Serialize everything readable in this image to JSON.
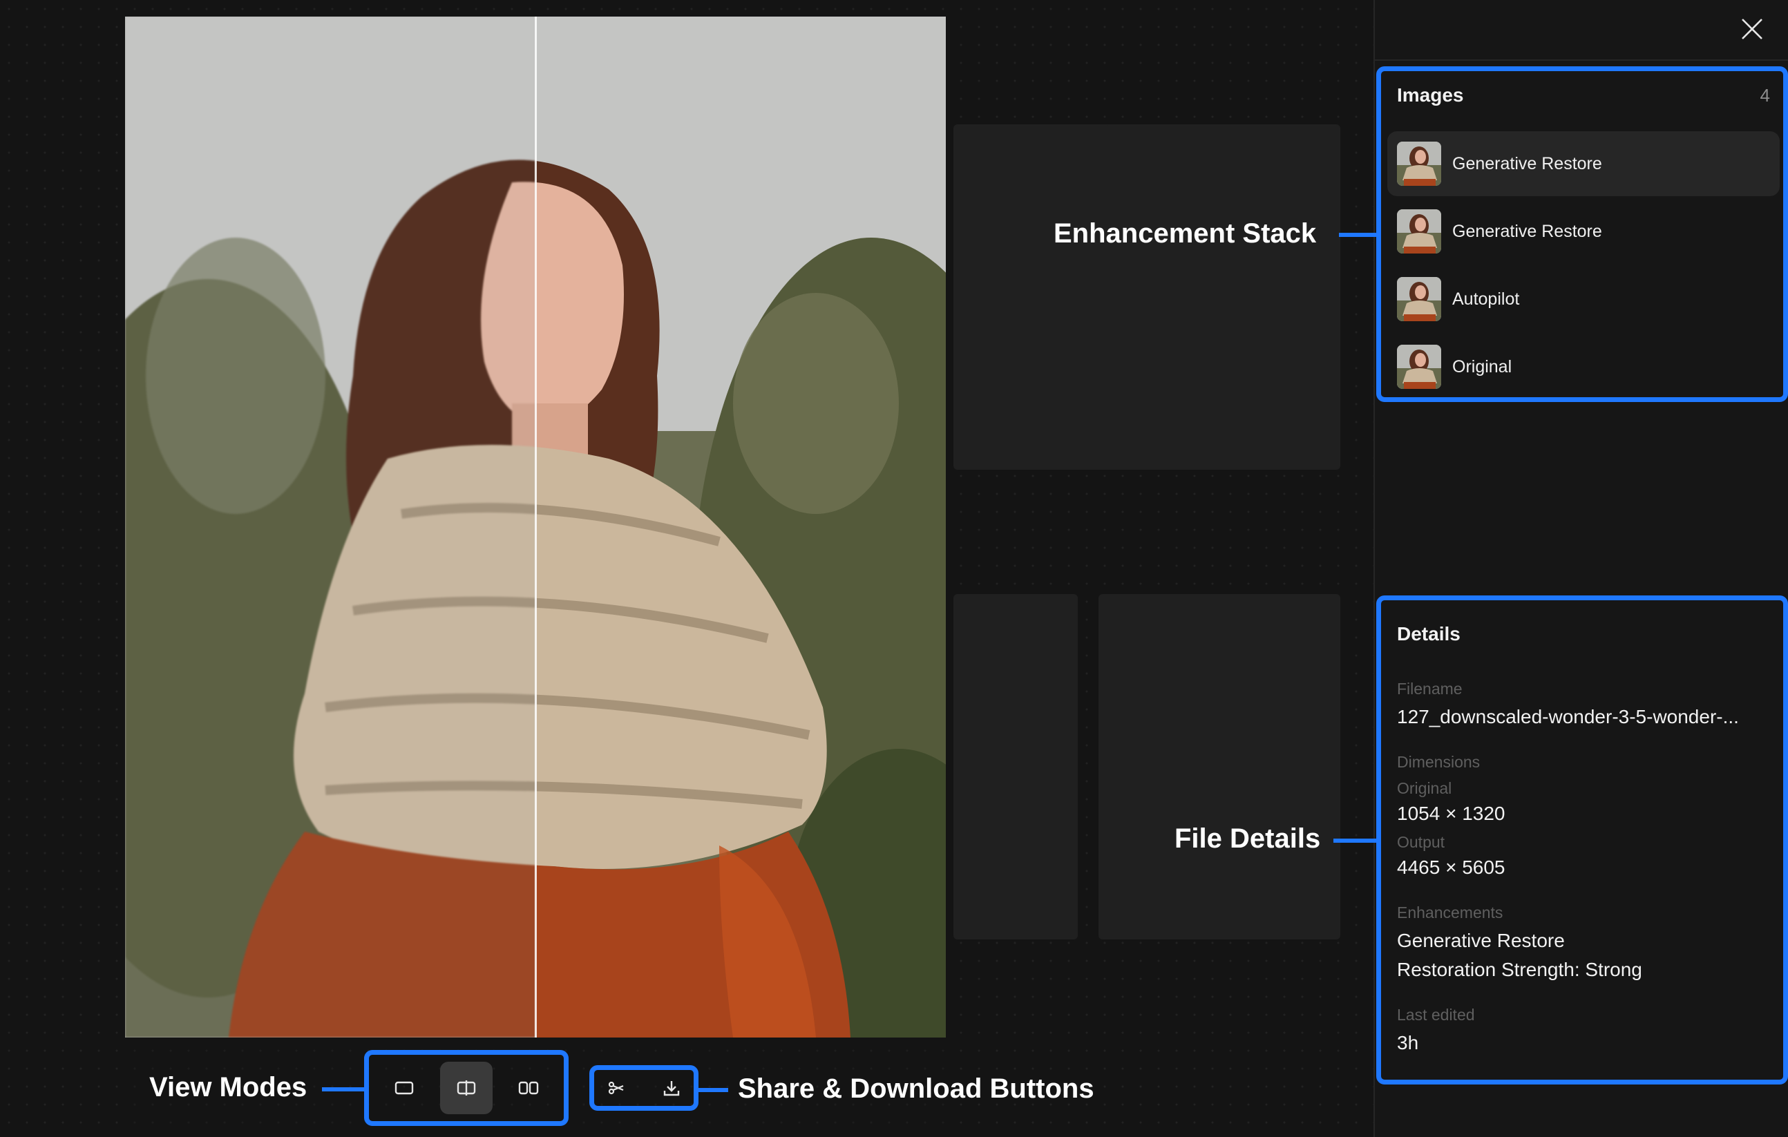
{
  "callouts": {
    "enhancement_stack": "Enhancement Stack",
    "file_details": "File Details",
    "view_modes": "View Modes",
    "share_download": "Share & Download Buttons"
  },
  "images_panel": {
    "title": "Images",
    "count": "4",
    "items": [
      {
        "label": "Generative Restore",
        "selected": true
      },
      {
        "label": "Generative Restore",
        "selected": false
      },
      {
        "label": "Autopilot",
        "selected": false
      },
      {
        "label": "Original",
        "selected": false
      }
    ]
  },
  "details": {
    "title": "Details",
    "filename_label": "Filename",
    "filename": "127_downscaled-wonder-3-5-wonder-...",
    "dimensions_label": "Dimensions",
    "original_label": "Original",
    "original_value": "1054 × 1320",
    "output_label": "Output",
    "output_value": "4465 × 5605",
    "enhancements_label": "Enhancements",
    "enhancement_1": "Generative Restore",
    "enhancement_2": "Restoration Strength: Strong",
    "last_edited_label": "Last edited",
    "last_edited_value": "3h"
  },
  "colors": {
    "accent": "#1f78ff",
    "background": "#141414",
    "sidebar": "#161616"
  },
  "icons": {
    "close": "close-icon",
    "single_view": "single-view-icon",
    "split_view": "split-view-icon",
    "side_by_side": "side-by-side-icon",
    "share": "share-icon",
    "download": "download-icon"
  }
}
